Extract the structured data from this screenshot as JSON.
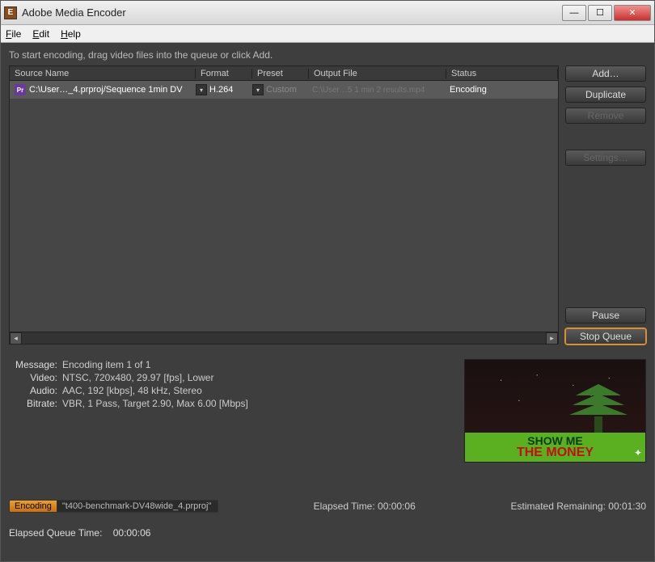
{
  "window": {
    "title": "Adobe Media Encoder"
  },
  "menu": {
    "file": "File",
    "edit": "Edit",
    "help": "Help"
  },
  "hint": "To start encoding, drag video files into the queue or click Add.",
  "columns": {
    "name": "Source Name",
    "format": "Format",
    "preset": "Preset",
    "output": "Output File",
    "status": "Status"
  },
  "row": {
    "name": "C:\\User…_4.prproj/Sequence 1min DV",
    "format": "H.264",
    "preset": "Custom",
    "output": "C:\\User…5 1 min 2 results.mp4",
    "status": "Encoding"
  },
  "buttons": {
    "add": "Add…",
    "duplicate": "Duplicate",
    "remove": "Remove",
    "settings": "Settings…",
    "pause": "Pause",
    "stop": "Stop Queue"
  },
  "info": {
    "message_label": "Message:",
    "message": "Encoding item 1 of 1",
    "video_label": "Video:",
    "video": "NTSC, 720x480, 29.97 [fps], Lower",
    "audio_label": "Audio:",
    "audio": "AAC, 192 [kbps], 48 kHz, Stereo",
    "bitrate_label": "Bitrate:",
    "bitrate": "VBR, 1 Pass, Target 2.90, Max 6.00 [Mbps]"
  },
  "preview": {
    "l1": "SHOW ME",
    "l2": "THE MONEY"
  },
  "progress": {
    "state": "Encoding",
    "file": "\"t400-benchmark-DV48wide_4.prproj\"",
    "elapsed_label": "Elapsed Time:",
    "elapsed": "00:00:06",
    "remain_label": "Estimated Remaining:",
    "remain": "00:01:30"
  },
  "queue_elapsed_label": "Elapsed Queue Time:",
  "queue_elapsed": "00:00:06"
}
